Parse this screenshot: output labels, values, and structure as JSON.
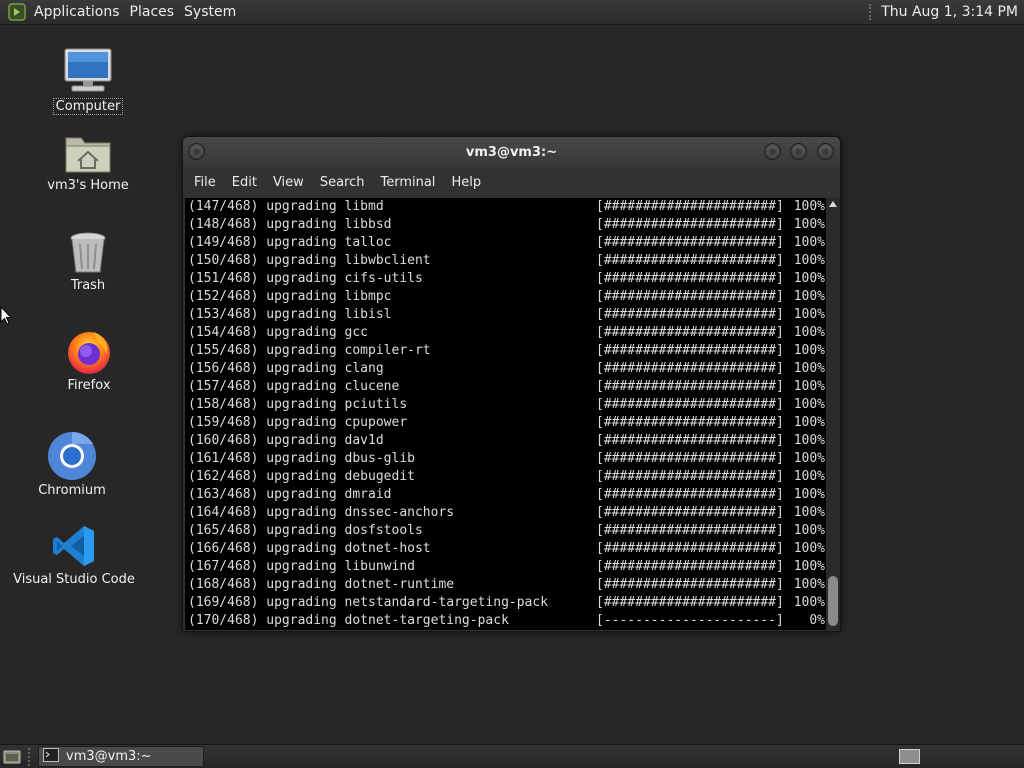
{
  "top_panel": {
    "menus": [
      "Applications",
      "Places",
      "System"
    ],
    "clock": "Thu Aug  1,  3:14 PM"
  },
  "desktop_icons": [
    {
      "label": "Computer",
      "icon": "computer-icon"
    },
    {
      "label": "vm3's Home",
      "icon": "home-folder-icon"
    },
    {
      "label": "Trash",
      "icon": "trash-icon"
    },
    {
      "label": "Firefox",
      "icon": "firefox-icon"
    },
    {
      "label": "Chromium",
      "icon": "chromium-icon"
    },
    {
      "label": "Visual Studio Code",
      "icon": "vscode-icon"
    }
  ],
  "window": {
    "title": "vm3@vm3:~",
    "menu": [
      "File",
      "Edit",
      "View",
      "Search",
      "Terminal",
      "Help"
    ]
  },
  "terminal": {
    "lines": [
      {
        "text": "(147/468) upgrading libmd",
        "bar": "[######################]",
        "pct": "100%"
      },
      {
        "text": "(148/468) upgrading libbsd",
        "bar": "[######################]",
        "pct": "100%"
      },
      {
        "text": "(149/468) upgrading talloc",
        "bar": "[######################]",
        "pct": "100%"
      },
      {
        "text": "(150/468) upgrading libwbclient",
        "bar": "[######################]",
        "pct": "100%"
      },
      {
        "text": "(151/468) upgrading cifs-utils",
        "bar": "[######################]",
        "pct": "100%"
      },
      {
        "text": "(152/468) upgrading libmpc",
        "bar": "[######################]",
        "pct": "100%"
      },
      {
        "text": "(153/468) upgrading libisl",
        "bar": "[######################]",
        "pct": "100%"
      },
      {
        "text": "(154/468) upgrading gcc",
        "bar": "[######################]",
        "pct": "100%"
      },
      {
        "text": "(155/468) upgrading compiler-rt",
        "bar": "[######################]",
        "pct": "100%"
      },
      {
        "text": "(156/468) upgrading clang",
        "bar": "[######################]",
        "pct": "100%"
      },
      {
        "text": "(157/468) upgrading clucene",
        "bar": "[######################]",
        "pct": "100%"
      },
      {
        "text": "(158/468) upgrading pciutils",
        "bar": "[######################]",
        "pct": "100%"
      },
      {
        "text": "(159/468) upgrading cpupower",
        "bar": "[######################]",
        "pct": "100%"
      },
      {
        "text": "(160/468) upgrading dav1d",
        "bar": "[######################]",
        "pct": "100%"
      },
      {
        "text": "(161/468) upgrading dbus-glib",
        "bar": "[######################]",
        "pct": "100%"
      },
      {
        "text": "(162/468) upgrading debugedit",
        "bar": "[######################]",
        "pct": "100%"
      },
      {
        "text": "(163/468) upgrading dmraid",
        "bar": "[######################]",
        "pct": "100%"
      },
      {
        "text": "(164/468) upgrading dnssec-anchors",
        "bar": "[######################]",
        "pct": "100%"
      },
      {
        "text": "(165/468) upgrading dosfstools",
        "bar": "[######################]",
        "pct": "100%"
      },
      {
        "text": "(166/468) upgrading dotnet-host",
        "bar": "[######################]",
        "pct": "100%"
      },
      {
        "text": "(167/468) upgrading libunwind",
        "bar": "[######################]",
        "pct": "100%"
      },
      {
        "text": "(168/468) upgrading dotnet-runtime",
        "bar": "[######################]",
        "pct": "100%"
      },
      {
        "text": "(169/468) upgrading netstandard-targeting-pack",
        "bar": "[######################]",
        "pct": "100%"
      },
      {
        "text": "(170/468) upgrading dotnet-targeting-pack",
        "bar": "[----------------------]",
        "pct": "0%"
      }
    ]
  },
  "taskbar": {
    "tasks": [
      {
        "label": "vm3@vm3:~",
        "icon": "terminal-icon"
      }
    ]
  },
  "colors": {
    "desktop_bg": "#272727",
    "terminal_bg": "#000000",
    "terminal_fg": "#dcdcdc"
  }
}
